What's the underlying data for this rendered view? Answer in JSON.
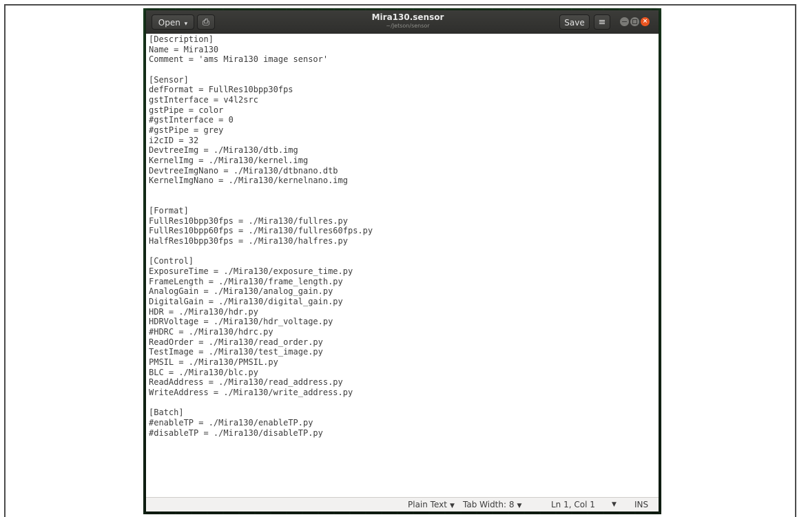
{
  "window": {
    "title": "Mira130.sensor",
    "subtitle": "~/Jetson/sensor",
    "open_label": "Open",
    "open_arrow": "▾",
    "file_icon": "⎙",
    "save_label": "Save",
    "menu_icon": "≡",
    "close_glyph": "×"
  },
  "editor": {
    "lines": [
      "[Description]",
      "Name = Mira130",
      "Comment = 'ams Mira130 image sensor'",
      "",
      "[Sensor]",
      "defFormat = FullRes10bpp30fps",
      "gstInterface = v4l2src",
      "gstPipe = color",
      "#gstInterface = 0",
      "#gstPipe = grey",
      "i2cID = 32",
      "DevtreeImg = ./Mira130/dtb.img",
      "KernelImg = ./Mira130/kernel.img",
      "DevtreeImgNano = ./Mira130/dtbnano.dtb",
      "KernelImgNano = ./Mira130/kernelnano.img",
      "",
      "",
      "[Format]",
      "FullRes10bpp30fps = ./Mira130/fullres.py",
      "FullRes10bpp60fps = ./Mira130/fullres60fps.py",
      "HalfRes10bpp30fps = ./Mira130/halfres.py",
      "",
      "[Control]",
      "ExposureTime = ./Mira130/exposure_time.py",
      "FrameLength = ./Mira130/frame_length.py",
      "AnalogGain = ./Mira130/analog_gain.py",
      "DigitalGain = ./Mira130/digital_gain.py",
      "HDR = ./Mira130/hdr.py",
      "HDRVoltage = ./Mira130/hdr_voltage.py",
      "#HDRC = ./Mira130/hdrc.py",
      "ReadOrder = ./Mira130/read_order.py",
      "TestImage = ./Mira130/test_image.py",
      "PMSIL = ./Mira130/PMSIL.py",
      "BLC = ./Mira130/blc.py",
      "ReadAddress = ./Mira130/read_address.py",
      "WriteAddress = ./Mira130/write_address.py",
      "",
      "[Batch]",
      "#enableTP = ./Mira130/enableTP.py",
      "#disableTP = ./Mira130/disableTP.py"
    ]
  },
  "statusbar": {
    "language": "Plain Text",
    "tab_width": "Tab Width: 8",
    "dropdown_arrow": "▼",
    "position": "Ln 1, Col 1",
    "mode": "INS"
  },
  "colors": {
    "headerbar": "#2e2e2c",
    "close_button": "#e95420",
    "editor_text": "#3c3c3c",
    "statusbar": "#f2f1f0"
  }
}
